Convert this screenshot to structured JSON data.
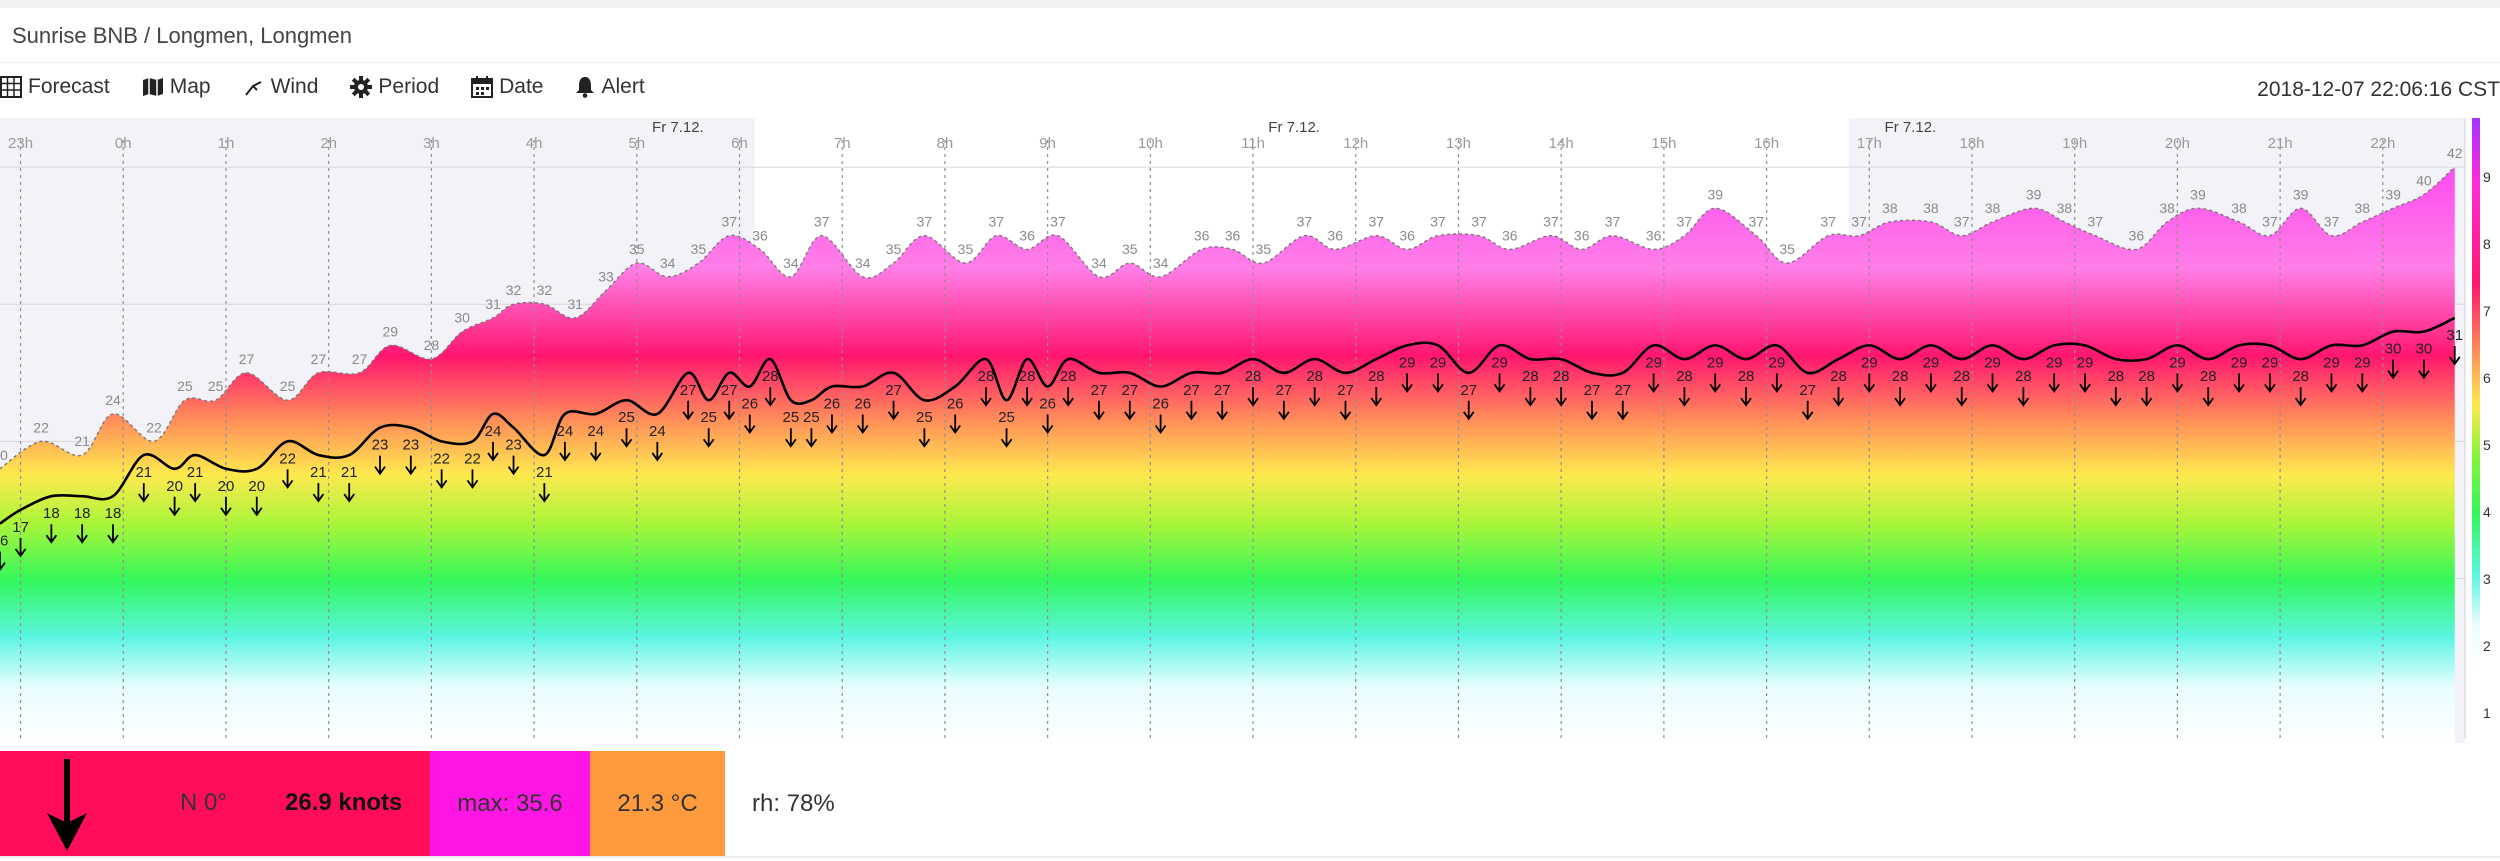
{
  "header": {
    "title": "Sunrise BNB / Longmen, Longmen"
  },
  "toolbar": {
    "items": [
      {
        "label": "Forecast",
        "icon": "grid-icon"
      },
      {
        "label": "Map",
        "icon": "map-icon"
      },
      {
        "label": "Wind",
        "icon": "wind-icon"
      },
      {
        "label": "Period",
        "icon": "gear-icon"
      },
      {
        "label": "Date",
        "icon": "calendar-icon"
      },
      {
        "label": "Alert",
        "icon": "bell-icon"
      }
    ],
    "timestamp": "2018-12-07 22:06:16 CST"
  },
  "info": {
    "direction": "N 0°",
    "speed": "26.9 knots",
    "max": "max: 35.6",
    "temperature": "21.3 °C",
    "humidity": "rh: 78%",
    "colors": {
      "speed": "#ff0d5a",
      "max": "#ff16e4",
      "temperature": "#ff9b3d"
    }
  },
  "chart_data": {
    "type": "area",
    "x_ticks": [
      "23h",
      "0h",
      "1h",
      "2h",
      "3h",
      "4h",
      "5h",
      "6h",
      "7h",
      "8h",
      "9h",
      "10h",
      "11h",
      "12h",
      "13h",
      "14h",
      "15h",
      "16h",
      "17h",
      "18h",
      "19h",
      "20h",
      "21h",
      "22h"
    ],
    "date_labels": [
      {
        "label": "Fr 7.12.",
        "at": 5.8
      },
      {
        "label": "Fr 7.12.",
        "at": 11.8
      },
      {
        "label": "Fr 7.12.",
        "at": 17.8
      }
    ],
    "shaded_ranges": [
      [
        -0.8,
        6.55
      ],
      [
        17.2,
        23.2
      ]
    ],
    "x_range": [
      -0.8,
      23.2
    ],
    "y_range": [
      0,
      45
    ],
    "legend_ticks": [
      1,
      2,
      3,
      4,
      5,
      6,
      7,
      8,
      9
    ],
    "arrow_direction": "N",
    "series": [
      {
        "name": "gust",
        "x": [
          -0.8,
          -0.4,
          0.0,
          0.3,
          0.7,
          1.0,
          1.3,
          1.6,
          2.0,
          2.3,
          2.7,
          3.0,
          3.4,
          3.7,
          4.0,
          4.2,
          4.5,
          4.8,
          5.1,
          5.4,
          5.7,
          6.0,
          6.3,
          6.6,
          6.9,
          7.2,
          7.6,
          7.9,
          8.2,
          8.6,
          8.9,
          9.2,
          9.5,
          9.9,
          10.2,
          10.5,
          10.9,
          11.2,
          11.5,
          11.9,
          12.2,
          12.6,
          12.9,
          13.2,
          13.6,
          13.9,
          14.3,
          14.6,
          14.9,
          15.3,
          15.6,
          15.9,
          16.3,
          16.6,
          17.0,
          17.3,
          17.6,
          18.0,
          18.3,
          18.6,
          19.0,
          19.3,
          19.6,
          20.0,
          20.3,
          20.6,
          21.0,
          21.3,
          21.6,
          21.9,
          22.2,
          22.5,
          22.8,
          23.1
        ],
        "y": [
          20,
          22,
          21,
          24,
          22,
          25,
          25,
          27,
          25,
          27,
          27,
          29,
          28,
          30,
          31,
          32,
          32,
          31,
          33,
          35,
          34,
          35,
          37,
          36,
          34,
          37,
          34,
          35,
          37,
          35,
          37,
          36,
          37,
          34,
          35,
          34,
          36,
          36,
          35,
          37,
          36,
          37,
          36,
          37,
          37,
          36,
          37,
          36,
          37,
          36,
          37,
          39,
          37,
          35,
          37,
          37,
          38,
          38,
          37,
          38,
          39,
          38,
          37,
          36,
          38,
          39,
          38,
          37,
          39,
          37,
          38,
          39,
          40,
          42
        ]
      },
      {
        "name": "wind",
        "x": [
          -0.8,
          -0.6,
          -0.3,
          0.0,
          0.3,
          0.6,
          0.9,
          1.1,
          1.4,
          1.7,
          2.0,
          2.3,
          2.6,
          2.9,
          3.2,
          3.5,
          3.8,
          4.0,
          4.2,
          4.5,
          4.7,
          5.0,
          5.3,
          5.6,
          5.9,
          6.1,
          6.3,
          6.5,
          6.7,
          6.9,
          7.1,
          7.3,
          7.6,
          7.9,
          8.2,
          8.5,
          8.8,
          9.0,
          9.2,
          9.4,
          9.6,
          9.9,
          10.2,
          10.5,
          10.8,
          11.1,
          11.4,
          11.7,
          12.0,
          12.3,
          12.6,
          12.9,
          13.2,
          13.5,
          13.8,
          14.1,
          14.4,
          14.7,
          15.0,
          15.3,
          15.6,
          15.9,
          16.2,
          16.5,
          16.8,
          17.1,
          17.4,
          17.7,
          18.0,
          18.3,
          18.6,
          18.9,
          19.2,
          19.5,
          19.8,
          20.1,
          20.4,
          20.7,
          21.0,
          21.3,
          21.6,
          21.9,
          22.2,
          22.5,
          22.8,
          23.1
        ],
        "y": [
          16,
          17,
          18,
          18,
          18,
          21,
          20,
          21,
          20,
          20,
          22,
          21,
          21,
          23,
          23,
          22,
          22,
          24,
          23,
          21,
          24,
          24,
          25,
          24,
          27,
          25,
          27,
          26,
          28,
          25,
          25,
          26,
          26,
          27,
          25,
          26,
          28,
          25,
          28,
          26,
          28,
          27,
          27,
          26,
          27,
          27,
          28,
          27,
          28,
          27,
          28,
          29,
          29,
          27,
          29,
          28,
          28,
          27,
          27,
          29,
          28,
          29,
          28,
          29,
          27,
          28,
          29,
          28,
          29,
          28,
          29,
          28,
          29,
          29,
          28,
          28,
          29,
          28,
          29,
          29,
          28,
          29,
          29,
          30,
          30,
          31
        ]
      }
    ]
  }
}
